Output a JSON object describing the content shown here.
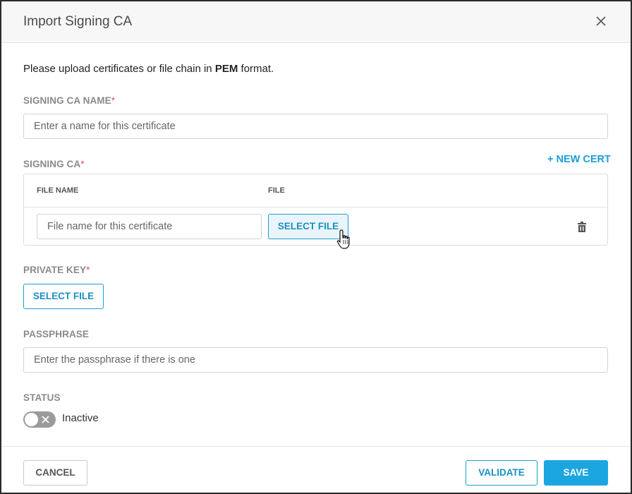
{
  "dialog": {
    "title": "Import Signing CA",
    "close_icon": "close-icon"
  },
  "intro": {
    "text_before": "Please upload certificates or file chain in ",
    "text_bold": "PEM",
    "text_after": " format."
  },
  "signing_ca_name": {
    "label": "SIGNING CA NAME",
    "required_mark": "*",
    "placeholder": "Enter a name for this certificate",
    "value": ""
  },
  "signing_ca": {
    "label": "SIGNING CA",
    "required_mark": "*",
    "new_cert_label": "+ NEW CERT",
    "columns": [
      "FILE NAME",
      "FILE"
    ],
    "rows": [
      {
        "file_name_placeholder": "File name for this certificate",
        "file_name_value": "",
        "select_file_label": "SELECT FILE",
        "delete_icon": "trash-icon"
      }
    ]
  },
  "private_key": {
    "label": "PRIVATE KEY",
    "required_mark": "*",
    "select_file_label": "SELECT FILE"
  },
  "passphrase": {
    "label": "PASSPHRASE",
    "placeholder": "Enter the passphrase if there is one",
    "value": ""
  },
  "status": {
    "label": "STATUS",
    "toggle_state": "off",
    "toggle_text": "Inactive"
  },
  "footer": {
    "cancel_label": "CANCEL",
    "validate_label": "VALIDATE",
    "save_label": "SAVE"
  },
  "colors": {
    "accent": "#1ca6e0",
    "link": "#1ba0d6",
    "required": "#e05252",
    "toggle_off": "#9b9b9b"
  }
}
